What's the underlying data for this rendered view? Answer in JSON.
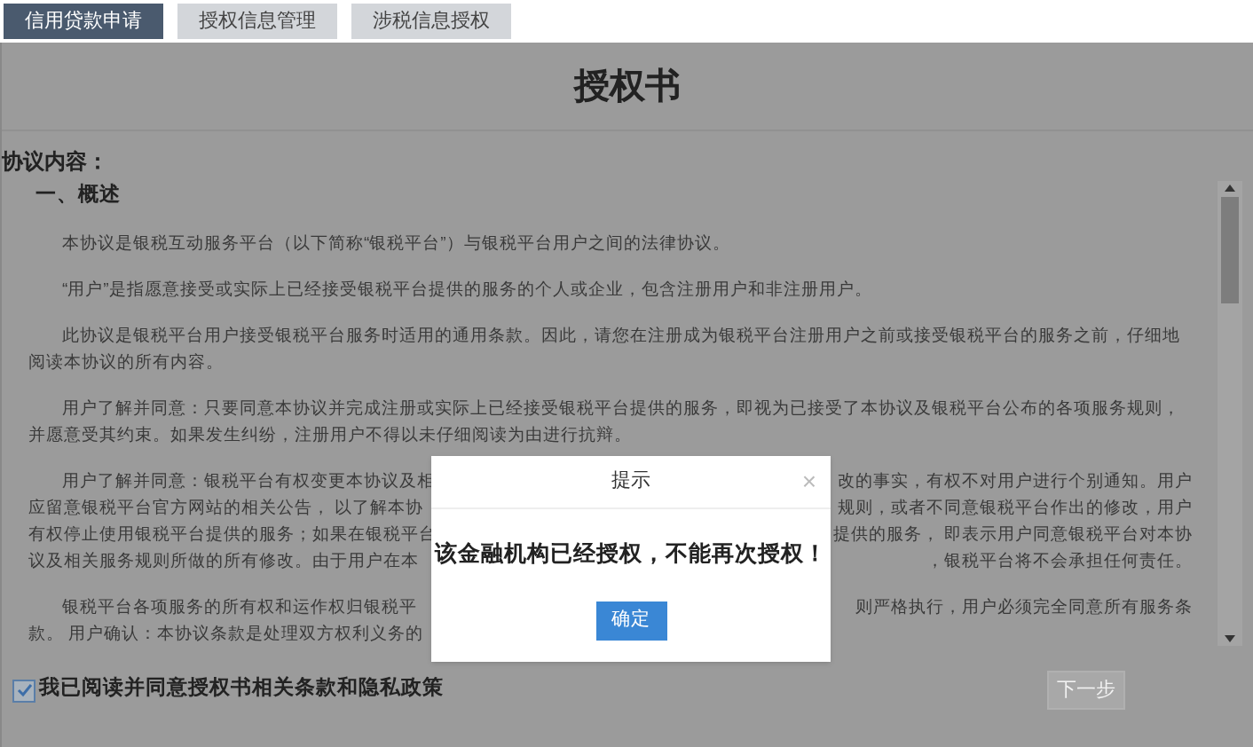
{
  "tabs": [
    {
      "label": "信用贷款申请",
      "selected": true
    },
    {
      "label": "授权信息管理",
      "selected": false
    },
    {
      "label": "涉税信息授权",
      "selected": false
    }
  ],
  "document": {
    "title": "授权书",
    "section_label": "协议内容：",
    "heading": "一、概述",
    "paragraphs": [
      {
        "kind": "text",
        "text": "本协议是银税互动服务平台（以下简称“银税平台”）与银税平台用户之间的法律协议。"
      },
      {
        "kind": "text",
        "text": "“用户”是指愿意接受或实际上已经接受银税平台提供的服务的个人或企业，包含注册用户和非注册用户。"
      },
      {
        "kind": "text",
        "text": "此协议是银税平台用户接受银税平台服务时适用的通用条款。因此，请您在注册成为银税平台注册用户之前或接受银税平台的服务之前，仔细地阅读本协议的所有内容。"
      },
      {
        "kind": "text",
        "text": "用户了解并同意：只要同意本协议并完成注册或实际上已经接受银税平台提供的服务，即视为已接受了本协议及银税平台公布的各项服务规则，并愿意受其约束。如果发生纠纷，注册用户不得以未仔细阅读为由进行抗辩。"
      },
      {
        "kind": "covered",
        "lines": [
          {
            "left": "用户了解并同意：银税平台有权变更本协议及相",
            "right": "改的事实，有权不对用户进行个别通知。用户"
          },
          {
            "left": "应留意银税平台官方网站的相关公告， 以了解本协",
            "right": "规则，或者不同意银税平台作出的修改，用户"
          },
          {
            "left": "有权停止使用银税平台提供的服务；如果在银税平台",
            "right": "提供的服务， 即表示用户同意银税平台对本协"
          },
          {
            "left": "议及相关服务规则所做的所有修改。由于用户在本",
            "right": "，银税平台将不会承担任何责任。"
          }
        ]
      },
      {
        "kind": "covered",
        "lines": [
          {
            "left": "银税平台各项服务的所有权和运作权归银税平",
            "right": "则严格执行，用户必须完全同意所有服务条"
          },
          {
            "left": "款。 用户确认：本协议条款是处理双方权利义务的"
          }
        ]
      }
    ]
  },
  "agreement": {
    "label": "我已阅读并同意授权书相关条款和隐私政策",
    "checked": true
  },
  "next_button": {
    "label": "下一步",
    "disabled": true
  },
  "dialog": {
    "title": "提示",
    "close": "×",
    "message": "该金融机构已经授权，不能再次授权！",
    "confirm": "确定"
  }
}
